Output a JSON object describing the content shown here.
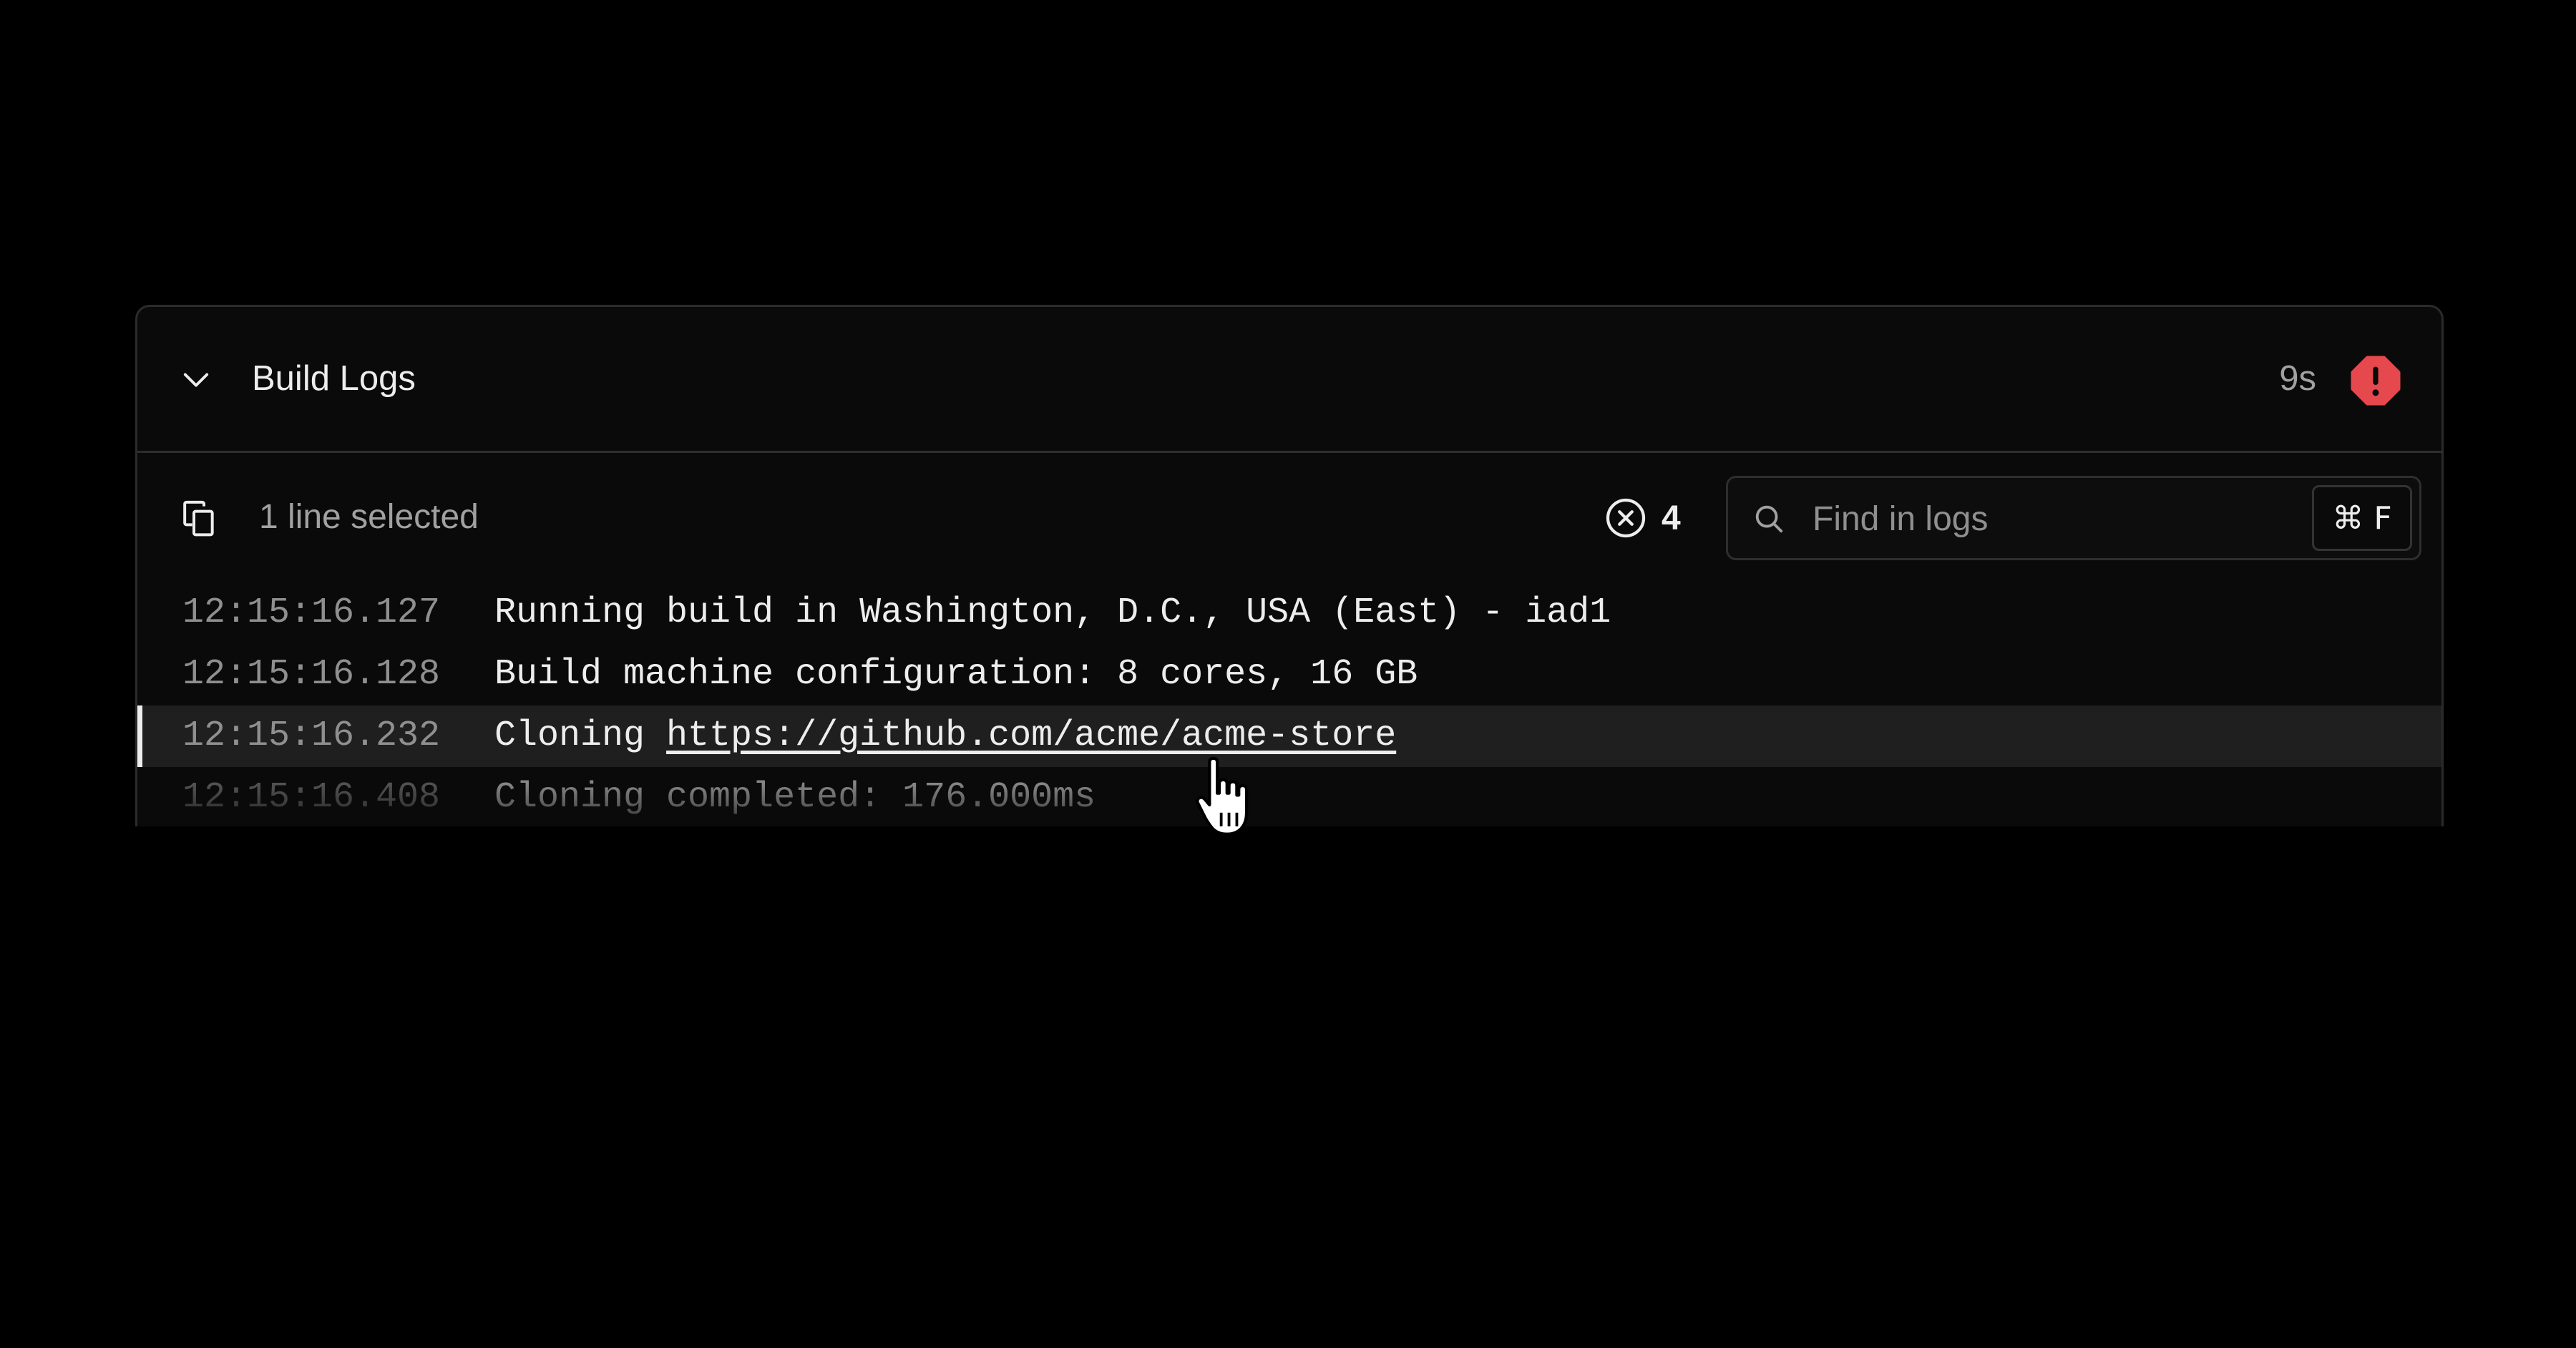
{
  "panel": {
    "title": "Build Logs",
    "duration": "9s",
    "status_icon": "error-icon"
  },
  "toolbar": {
    "selection_label": "1 line selected",
    "error_count": "4",
    "search": {
      "placeholder": "Find in logs",
      "value": "",
      "shortcut": "⌘ F"
    }
  },
  "logs": [
    {
      "time": "12:15:16.127",
      "message": "Running build in Washington, D.C., USA (East) - iad1",
      "selected": false
    },
    {
      "time": "12:15:16.128",
      "message": "Build machine configuration: 8 cores, 16 GB",
      "selected": false
    },
    {
      "time": "12:15:16.232",
      "message_prefix": "Cloning ",
      "link": "https://github.com/acme/acme-store",
      "selected": true
    },
    {
      "time": "12:15:16.408",
      "message": "Cloning completed: 176.000ms",
      "selected": false
    }
  ],
  "colors": {
    "background": "#000000",
    "panel": "#0a0a0a",
    "error": "#e5484d",
    "text": "#ededed",
    "muted": "#a1a1a1"
  }
}
